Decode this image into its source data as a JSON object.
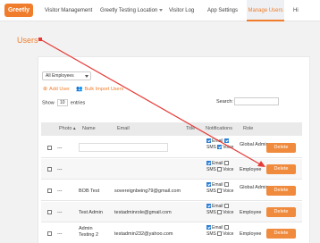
{
  "nav": {
    "logo": "Greetly",
    "items": [
      {
        "label": "Visitor Management"
      },
      {
        "label": "Greetly Testing Location"
      },
      {
        "label": "Visitor Log"
      },
      {
        "label": "App Settings"
      },
      {
        "label": "Manage Users"
      },
      {
        "label": "Hi"
      }
    ]
  },
  "page": {
    "title": "Users"
  },
  "filter": {
    "selected": "All Employees"
  },
  "actions": {
    "add_user": "Add User",
    "bulk_import": "Bulk Import Users"
  },
  "show": {
    "prefix": "Show",
    "value": "10",
    "suffix": "entries"
  },
  "search": {
    "label": "Search:",
    "value": ""
  },
  "table": {
    "headers": [
      "Photo",
      "Name",
      "Email",
      "Title",
      "Notifications",
      "Role"
    ],
    "email_label": "Email",
    "sms_label": "SMS",
    "voice_label": "Voice",
    "delete_label": "Delete",
    "rows": [
      {
        "photo": "---",
        "name": "",
        "email": "",
        "role": "Global Admin",
        "email_on": true,
        "sms_on": false,
        "voice_on": true
      },
      {
        "photo": "---",
        "name": "",
        "email": "",
        "role": "Employee",
        "email_on": true,
        "sms_on": false,
        "voice_on": false
      },
      {
        "photo": "---",
        "name": "BOB Test",
        "email": "sovereignbeing79@gmail.com",
        "role": "Global Admin",
        "email_on": true,
        "sms_on": false,
        "voice_on": false
      },
      {
        "photo": "---",
        "name": "Test Admin",
        "email": "testadminrole@gmail.com",
        "role": "Employee",
        "email_on": true,
        "sms_on": false,
        "voice_on": false
      },
      {
        "photo": "---",
        "name": "Admin Testing 2",
        "email": "testadmin232@yahoo.com",
        "role": "Employee",
        "email_on": true,
        "sms_on": false,
        "voice_on": false
      }
    ]
  },
  "colors": {
    "accent": "#f07d2c",
    "annotation": "#e53935"
  }
}
